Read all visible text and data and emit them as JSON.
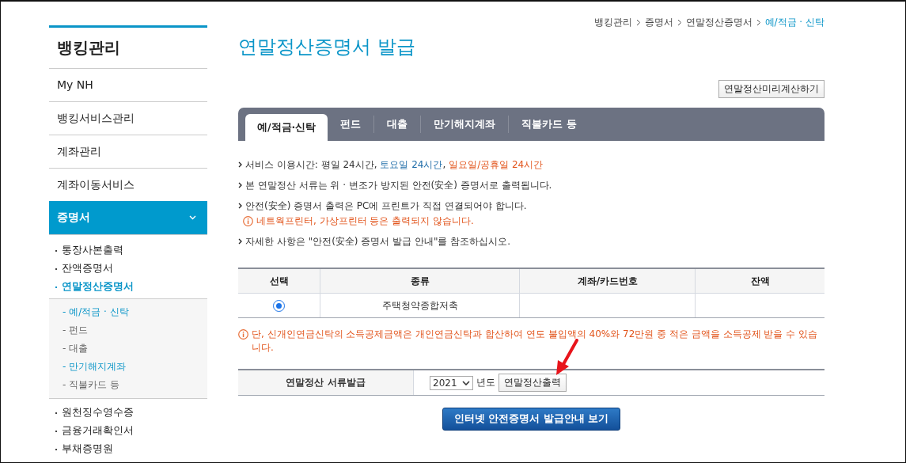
{
  "sidebar": {
    "title": "뱅킹관리",
    "items": [
      {
        "label": "My NH",
        "selected": false
      },
      {
        "label": "뱅킹서비스관리",
        "selected": false
      },
      {
        "label": "계좌관리",
        "selected": false
      },
      {
        "label": "계좌이동서비스",
        "selected": false
      },
      {
        "label": "증명서",
        "selected": true,
        "expanded": true,
        "children": [
          {
            "label": "통장사본출력",
            "selected": false
          },
          {
            "label": "잔액증명서",
            "selected": false
          },
          {
            "label": "연말정산증명서",
            "selected": true,
            "children": [
              {
                "label": "- 예/적금 · 신탁",
                "selected": true
              },
              {
                "label": "- 펀드",
                "selected": false
              },
              {
                "label": "- 대출",
                "selected": false
              },
              {
                "label": "- 만기해지계좌",
                "selected": true
              },
              {
                "label": "- 직불카드 등",
                "selected": false
              }
            ]
          },
          {
            "label": "원천징수영수증",
            "selected": false
          },
          {
            "label": "금융거래확인서",
            "selected": false
          },
          {
            "label": "부채증명원",
            "selected": false
          }
        ]
      }
    ]
  },
  "breadcrumb": [
    "뱅킹관리",
    "증명서",
    "연말정산증명서",
    "예/적금 · 신탁"
  ],
  "page_title": "연말정산증명서 발급",
  "preview_button": "연말정산미리계산하기",
  "tabs": [
    {
      "label": "예/적금·신탁",
      "selected": true
    },
    {
      "label": "펀드",
      "selected": false
    },
    {
      "label": "대출",
      "selected": false
    },
    {
      "label": "만기해지계좌",
      "selected": false
    },
    {
      "label": "직불카드 등",
      "selected": false
    }
  ],
  "notes": [
    {
      "segments": [
        {
          "text": "서비스 이용시간: 평일 24시간, ",
          "kind": "plain"
        },
        {
          "text": "토요일 24시간",
          "kind": "blue"
        },
        {
          "text": ", ",
          "kind": "plain"
        },
        {
          "text": "일요일/공휴일 24시간",
          "kind": "orange"
        }
      ]
    },
    {
      "segments": [
        {
          "text": "본 연말정산 서류는 위 · 변조가 방지된 안전(安全) 증명서로 출력됩니다.",
          "kind": "plain"
        }
      ]
    },
    {
      "segments": [
        {
          "text": "안전(安全) 증명서 출력은 PC에 프린트가 직접 연결되어야 합니다.",
          "kind": "plain"
        }
      ],
      "warning": "네트웍프린터, 가상프린터 등은 출력되지 않습니다."
    },
    {
      "segments": [
        {
          "text": "자세한 사항은 \"안전(安全) 증명서 발급 안내\"를 참조하십시오.",
          "kind": "plain"
        }
      ]
    }
  ],
  "table": {
    "columns": [
      "선택",
      "종류",
      "계좌/카드번호",
      "잔액"
    ],
    "rows": [
      {
        "selected": true,
        "type": "주택청약종합저축"
      }
    ]
  },
  "tax_notice": "단, 신개인연금신탁의 소득공제금액은 개인연금신탁과 합산하여 연도 불입액의 40%와 72만원 중 적은 금액을 소득공제 받을 수 있습니다.",
  "issue_form": {
    "label": "연말정산 서류발급",
    "year": "2021",
    "year_suffix": "년도",
    "print_button": "연말정산출력"
  },
  "guide_button": "인터넷 안전증명서 발급안내 보기"
}
